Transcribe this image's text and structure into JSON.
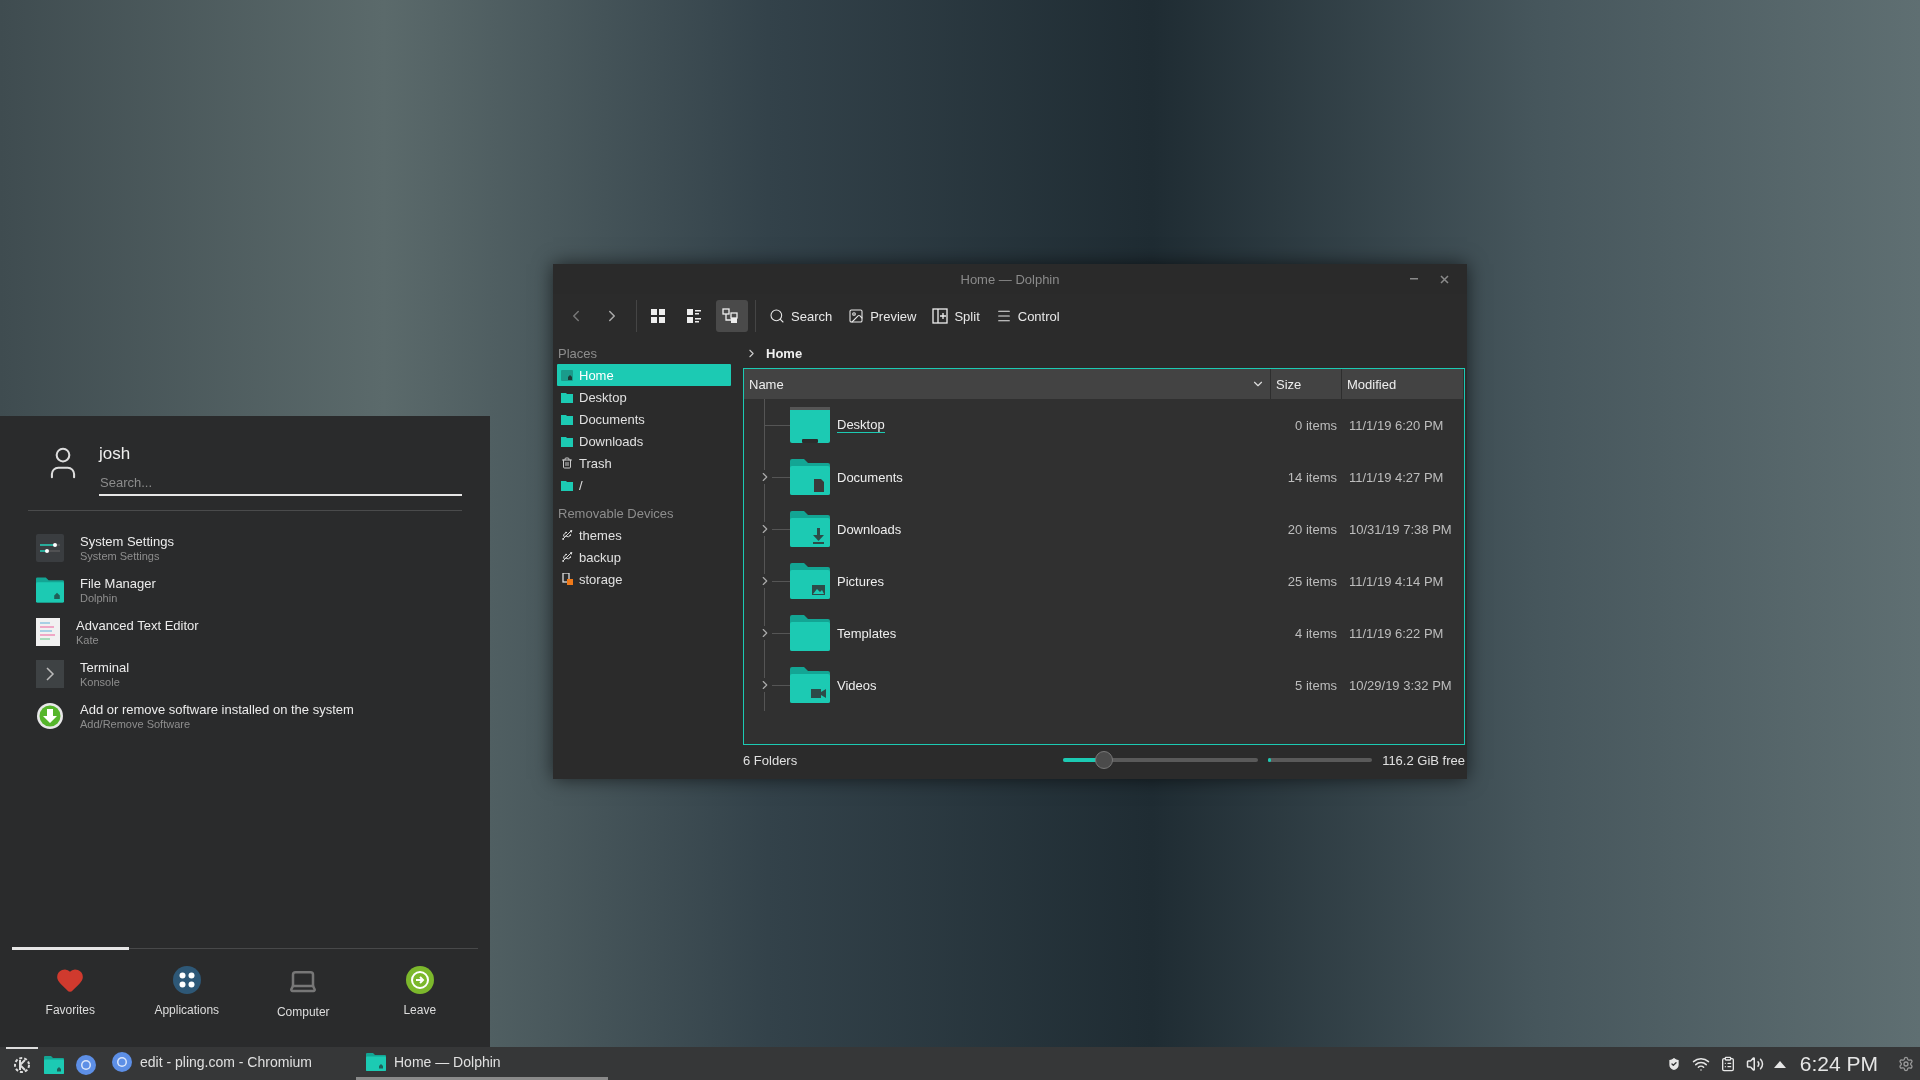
{
  "dolphin": {
    "title": "Home — Dolphin",
    "view_modes": [
      {
        "kind": "icons",
        "selected": false
      },
      {
        "kind": "compact",
        "selected": false
      },
      {
        "kind": "details",
        "selected": true
      }
    ],
    "actions": [
      {
        "kind": "search",
        "label": "Search"
      },
      {
        "kind": "preview",
        "label": "Preview"
      },
      {
        "kind": "split",
        "label": "Split"
      },
      {
        "kind": "control",
        "label": "Control"
      }
    ],
    "places": {
      "heading": "Places",
      "items": [
        {
          "label": "Home",
          "kind": "home",
          "selected": true
        },
        {
          "label": "Desktop",
          "kind": "folder",
          "selected": false
        },
        {
          "label": "Documents",
          "kind": "folder",
          "selected": false
        },
        {
          "label": "Downloads",
          "kind": "folder",
          "selected": false
        },
        {
          "label": "Trash",
          "kind": "trash",
          "selected": false
        },
        {
          "label": "/",
          "kind": "folder",
          "selected": false
        }
      ]
    },
    "removable": {
      "heading": "Removable Devices",
      "items": [
        {
          "label": "themes",
          "kind": "usb"
        },
        {
          "label": "backup",
          "kind": "usb"
        },
        {
          "label": "storage",
          "kind": "usb-warning"
        }
      ]
    },
    "breadcrumb": "Home",
    "columns": [
      "Name",
      "Size",
      "Modified"
    ],
    "rows": [
      {
        "name": "Desktop",
        "kind": "desktop",
        "expandable": false,
        "focused": true,
        "size": "0 items",
        "modified": "11/1/19 6:20 PM"
      },
      {
        "name": "Documents",
        "kind": "document",
        "expandable": true,
        "focused": false,
        "size": "14 items",
        "modified": "11/1/19 4:27 PM"
      },
      {
        "name": "Downloads",
        "kind": "download",
        "expandable": true,
        "focused": false,
        "size": "20 items",
        "modified": "10/31/19 7:38 PM"
      },
      {
        "name": "Pictures",
        "kind": "image",
        "expandable": true,
        "focused": false,
        "size": "25 items",
        "modified": "11/1/19 4:14 PM"
      },
      {
        "name": "Templates",
        "kind": "plain",
        "expandable": true,
        "focused": false,
        "size": "4 items",
        "modified": "11/1/19 6:22 PM"
      },
      {
        "name": "Videos",
        "kind": "video",
        "expandable": true,
        "focused": false,
        "size": "5 items",
        "modified": "10/29/19 3:32 PM"
      }
    ],
    "status": {
      "summary": "6 Folders",
      "zoom": {
        "level": 0.21
      },
      "space": {
        "level": 0.03
      },
      "free": "116.2 GiB free"
    }
  },
  "launcher": {
    "user": "josh",
    "search": {
      "placeholder": "Search..."
    },
    "items": [
      {
        "title": "System Settings",
        "subtitle": "System Settings",
        "kind": "settings"
      },
      {
        "title": "File Manager",
        "subtitle": "Dolphin",
        "kind": "files"
      },
      {
        "title": "Advanced Text Editor",
        "subtitle": "Kate",
        "kind": "editor"
      },
      {
        "title": "Terminal",
        "subtitle": "Konsole",
        "kind": "terminal"
      },
      {
        "title": "Add or remove software installed on the system",
        "subtitle": "Add/Remove Software",
        "kind": "software"
      }
    ],
    "tabs": [
      {
        "label": "Favorites",
        "kind": "favorites",
        "selected": true
      },
      {
        "label": "Applications",
        "kind": "applications",
        "selected": false
      },
      {
        "label": "Computer",
        "kind": "computer",
        "selected": false
      },
      {
        "label": "Leave",
        "kind": "leave",
        "selected": false
      }
    ]
  },
  "taskbar": {
    "launchers": [
      {
        "kind": "menu",
        "selected": true
      },
      {
        "kind": "files",
        "selected": false
      },
      {
        "kind": "browser",
        "selected": false
      }
    ],
    "tasks": [
      {
        "label": "edit - pling.com - Chromium",
        "kind": "browser",
        "selected": false
      },
      {
        "label": "Home — Dolphin",
        "kind": "files",
        "selected": true
      }
    ],
    "clock": "6:24 PM"
  }
}
